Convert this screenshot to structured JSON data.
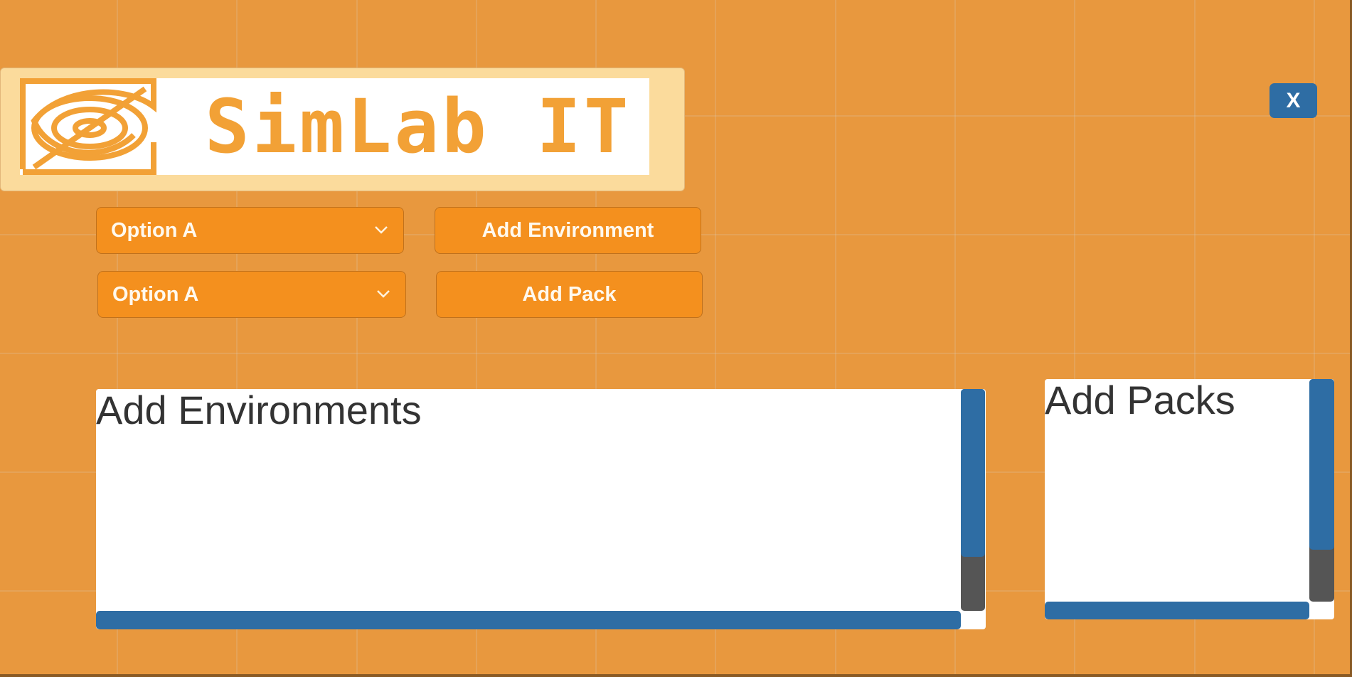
{
  "branding": {
    "logo_text": "SimLab IT",
    "logo_icon": "eye-target-icon",
    "accent_color": "#f2a136"
  },
  "window": {
    "close_label": "X"
  },
  "controls": {
    "environment_dropdown_value": "Option A",
    "pack_dropdown_value": "Option A",
    "add_environment_label": "Add Environment",
    "add_pack_label": "Add Pack"
  },
  "panels": {
    "environments_title": "Add Environments",
    "packs_title": "Add Packs"
  },
  "colors": {
    "background": "#e8983e",
    "button": "#f4901e",
    "scrollbar": "#2e6da4"
  }
}
